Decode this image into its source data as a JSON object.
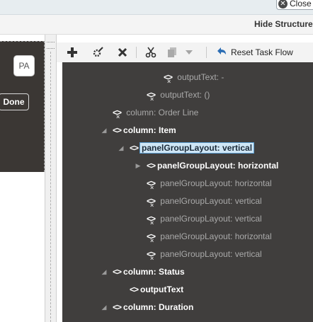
{
  "header": {
    "close_label": "Close",
    "hide_structure_label": "Hide Structure"
  },
  "left_panel": {
    "avatar_initials": "PA",
    "done_label": "Done"
  },
  "toolbar": {
    "add_icon": "plus-icon",
    "edit_icon": "gear-pencil-icon",
    "delete_icon": "x-icon",
    "cut_icon": "scissors-icon",
    "copy_icon": "copy-icon",
    "more_icon": "chevron-down-icon",
    "reset_label": "Reset Task Flow",
    "reset_icon": "undo-arrow-icon"
  },
  "colors": {
    "tree_bg": "#403e3d",
    "selected_bg": "#cfe6f5",
    "dim_text": "#a9a9a9"
  },
  "tree": {
    "nodes": [
      {
        "label": "outputText: -",
        "state": "dim"
      },
      {
        "label": "outputText: ()",
        "state": "dim"
      },
      {
        "label": "column: Order Line",
        "state": "dim"
      },
      {
        "label": "column: Item",
        "state": "bright"
      },
      {
        "label": "panelGroupLayout: vertical",
        "state": "selected"
      },
      {
        "label": "panelGroupLayout: horizontal",
        "state": "bright"
      },
      {
        "label": "panelGroupLayout: horizontal",
        "state": "dim"
      },
      {
        "label": "panelGroupLayout: vertical",
        "state": "dim"
      },
      {
        "label": "panelGroupLayout: vertical",
        "state": "dim"
      },
      {
        "label": "panelGroupLayout: horizontal",
        "state": "dim"
      },
      {
        "label": "panelGroupLayout: vertical",
        "state": "dim"
      },
      {
        "label": "column: Status",
        "state": "bright"
      },
      {
        "label": "outputText",
        "state": "bright"
      },
      {
        "label": "column: Duration",
        "state": "bright"
      }
    ]
  }
}
